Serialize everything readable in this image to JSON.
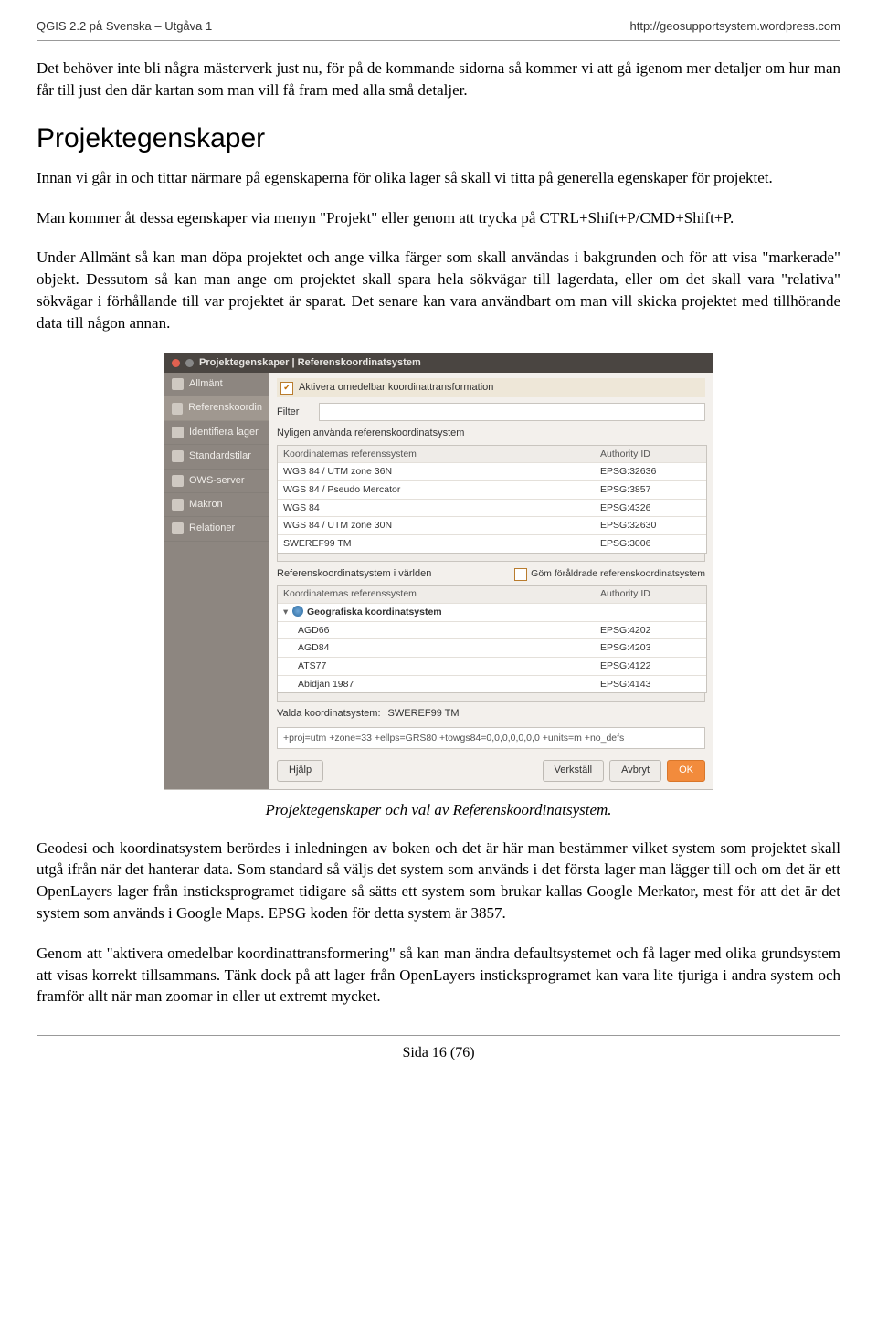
{
  "header": {
    "left": "QGIS 2.2 på Svenska – Utgåva 1",
    "right": "http://geosupportsystem.wordpress.com"
  },
  "para1": "Det behöver inte bli några mästerverk just nu, för på de kommande sidorna så kommer vi att gå igenom mer detaljer om hur man får till just den där kartan som man vill få fram med alla små detaljer.",
  "section_title": "Projektegenskaper",
  "para2": "Innan vi går in och tittar närmare på egenskaperna för olika lager så skall vi titta på generella egenskaper för projektet.",
  "para3": "Man kommer åt dessa egenskaper via menyn \"Projekt\" eller genom att trycka på CTRL+Shift+P/CMD+Shift+P.",
  "para4": "Under Allmänt så kan man döpa projektet och ange vilka färger som skall användas i bakgrunden och för att visa \"markerade\" objekt. Dessutom så kan man ange om projektet skall spara hela sökvägar till lagerdata, eller om det skall vara \"relativa\" sökvägar i förhållande till var projektet är sparat. Det senare kan vara användbart om man vill skicka projektet med tillhörande data till någon annan.",
  "caption": "Projektegenskaper och val av Referenskoordinatsystem.",
  "para5": "Geodesi och koordinatsystem berördes i inledningen av boken och det är här man bestämmer vilket system som projektet skall utgå ifrån när det hanterar data. Som standard så väljs det system som används i det första lager man lägger till och om det är ett OpenLayers lager från insticksprogramet tidigare så sätts ett system som brukar kallas Google Merkator, mest för att det är det system som används i Google Maps. EPSG koden för detta system är 3857.",
  "para6": "Genom att \"aktivera omedelbar koordinattransformering\" så kan man ändra defaultsystemet och få lager med olika grundsystem att visas korrekt tillsammans. Tänk dock på att lager från OpenLayers insticksprogramet kan vara lite tjuriga i andra system och framför allt när man zoomar in eller ut extremt mycket.",
  "footer": "Sida 16 (76)",
  "shot": {
    "title": "Projektegenskaper | Referenskoordinatsystem",
    "sidebar": [
      "Allmänt",
      "Referenskoordin",
      "Identifiera lager",
      "Standardstilar",
      "OWS-server",
      "Makron",
      "Relationer"
    ],
    "enable_label": "Aktivera omedelbar koordinattransformation",
    "filter_label": "Filter",
    "recent_label": "Nyligen använda referenskoordinatsystem",
    "col1": "Koordinaternas referenssystem",
    "col2": "Authority ID",
    "recent_rows": [
      {
        "n": "WGS 84 / UTM zone 36N",
        "a": "EPSG:32636"
      },
      {
        "n": "WGS 84 / Pseudo Mercator",
        "a": "EPSG:3857"
      },
      {
        "n": "WGS 84",
        "a": "EPSG:4326"
      },
      {
        "n": "WGS 84 / UTM zone 30N",
        "a": "EPSG:32630"
      },
      {
        "n": "SWEREF99 TM",
        "a": "EPSG:3006"
      }
    ],
    "world_label": "Referenskoordinatsystem i världen",
    "hide_label": "Göm föråldrade referenskoordinatsystem",
    "world_group": "Geografiska koordinatsystem",
    "world_rows": [
      {
        "n": "AGD66",
        "a": "EPSG:4202"
      },
      {
        "n": "AGD84",
        "a": "EPSG:4203"
      },
      {
        "n": "ATS77",
        "a": "EPSG:4122"
      },
      {
        "n": "Abidjan 1987",
        "a": "EPSG:4143"
      }
    ],
    "selected_label": "Valda koordinatsystem:",
    "selected_value": "SWEREF99 TM",
    "proj": "+proj=utm +zone=33 +ellps=GRS80 +towgs84=0,0,0,0,0,0,0 +units=m +no_defs",
    "btn_help": "Hjälp",
    "btn_apply": "Verkställ",
    "btn_cancel": "Avbryt",
    "btn_ok": "OK"
  }
}
